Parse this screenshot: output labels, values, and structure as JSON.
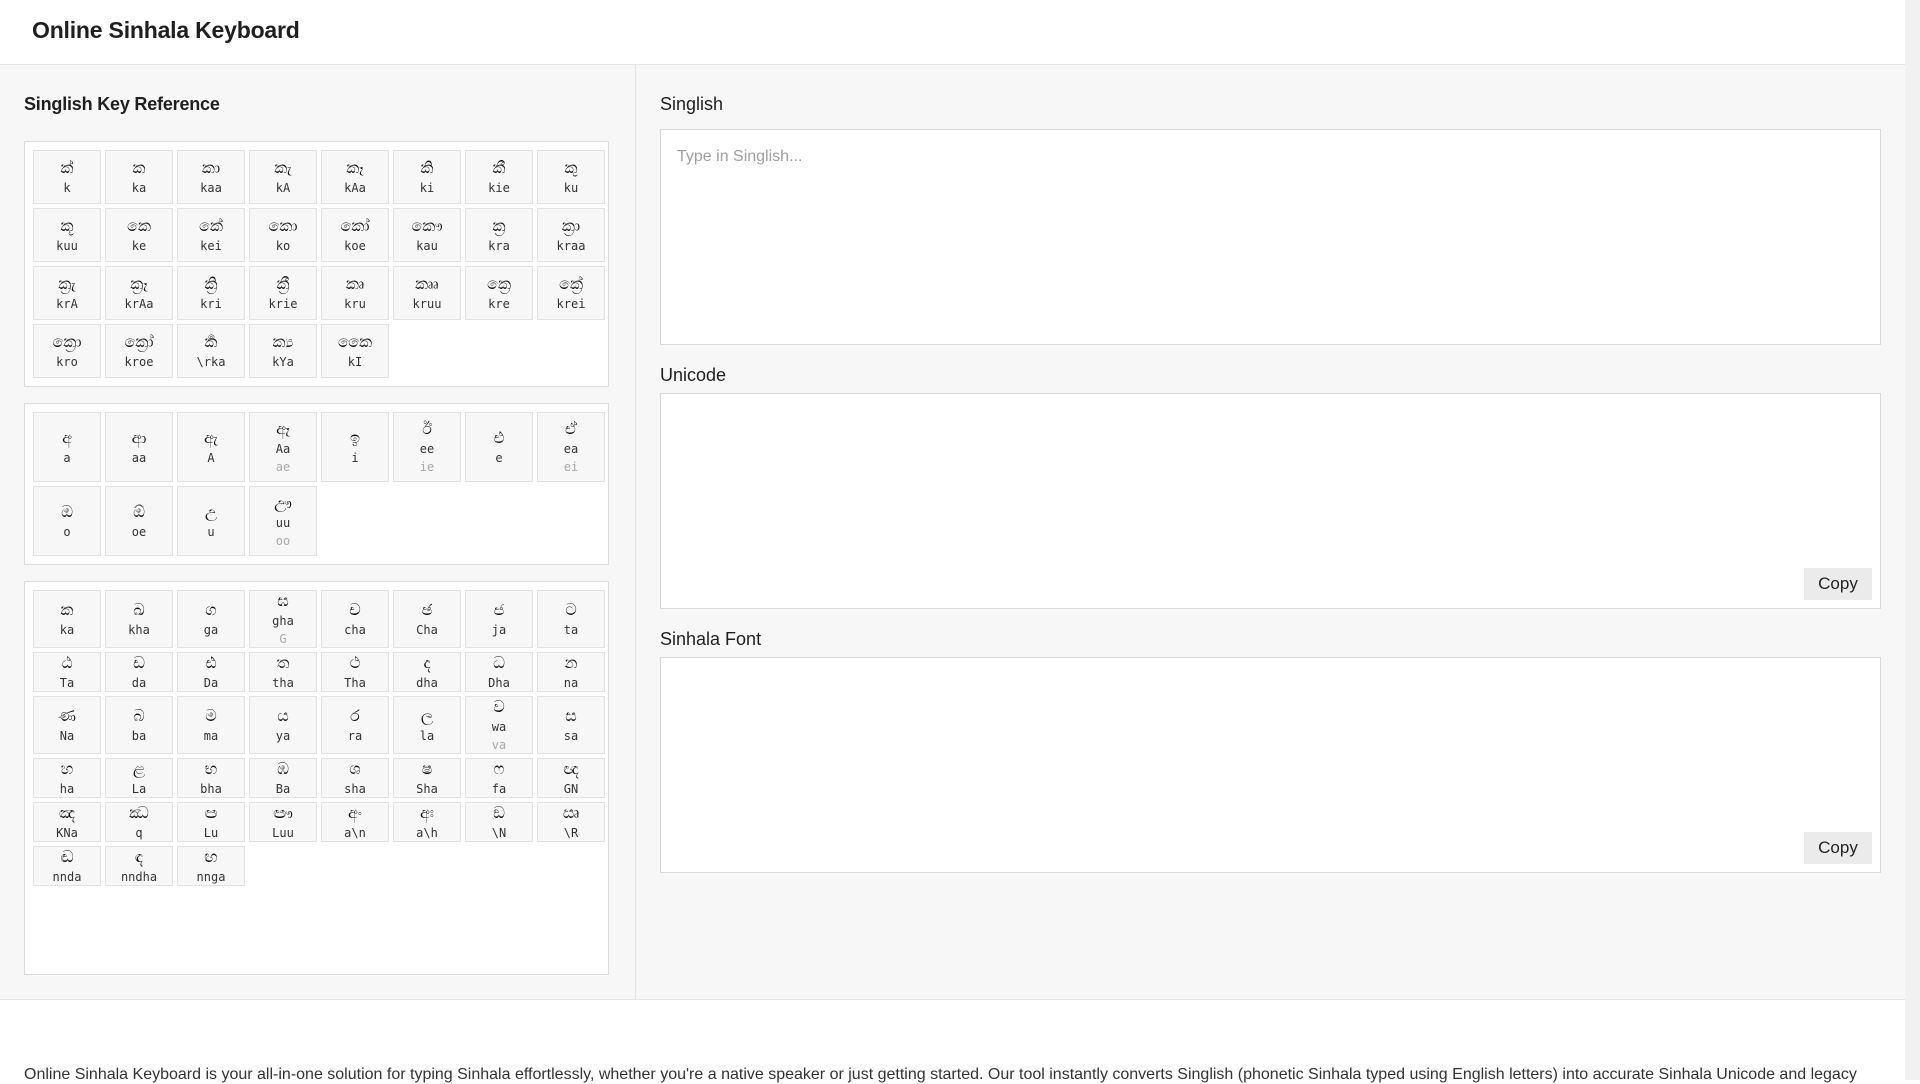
{
  "header": {
    "title": "Online Sinhala Keyboard"
  },
  "reference": {
    "title": "Singlish Key Reference",
    "groups": [
      {
        "id": "consonant-ka-forms",
        "keys": [
          {
            "si": "ක්",
            "latin": "k"
          },
          {
            "si": "ක",
            "latin": "ka"
          },
          {
            "si": "කා",
            "latin": "kaa"
          },
          {
            "si": "කැ",
            "latin": "kA"
          },
          {
            "si": "කෑ",
            "latin": "kAa"
          },
          {
            "si": "කි",
            "latin": "ki"
          },
          {
            "si": "කී",
            "latin": "kie"
          },
          {
            "si": "කු",
            "latin": "ku"
          },
          {
            "si": "කූ",
            "latin": "kuu"
          },
          {
            "si": "කෙ",
            "latin": "ke"
          },
          {
            "si": "කේ",
            "latin": "kei"
          },
          {
            "si": "කො",
            "latin": "ko"
          },
          {
            "si": "කෝ",
            "latin": "koe"
          },
          {
            "si": "කෞ",
            "latin": "kau"
          },
          {
            "si": "ක්‍ර",
            "latin": "kra"
          },
          {
            "si": "ක්‍රා",
            "latin": "kraa"
          },
          {
            "si": "ක්‍රැ",
            "latin": "krA"
          },
          {
            "si": "ක්‍රෑ",
            "latin": "krAa"
          },
          {
            "si": "ක්‍රි",
            "latin": "kri"
          },
          {
            "si": "ක්‍රී",
            "latin": "krie"
          },
          {
            "si": "කෘ",
            "latin": "kru"
          },
          {
            "si": "කෲ",
            "latin": "kruu"
          },
          {
            "si": "ක්‍රෙ",
            "latin": "kre"
          },
          {
            "si": "ක්‍රේ",
            "latin": "krei"
          },
          {
            "si": "ක්‍රො",
            "latin": "kro"
          },
          {
            "si": "ක්‍රෝ",
            "latin": "kroe"
          },
          {
            "si": "ර්‍ක",
            "latin": "\\rka"
          },
          {
            "si": "ක්‍ය",
            "latin": "kYa"
          },
          {
            "si": "කෛ",
            "latin": "kI"
          }
        ]
      },
      {
        "id": "vowels",
        "keys": [
          {
            "si": "අ",
            "latin": "a"
          },
          {
            "si": "ආ",
            "latin": "aa"
          },
          {
            "si": "ඇ",
            "latin": "A"
          },
          {
            "si": "ඈ",
            "latin": "Aa",
            "alt": "ae"
          },
          {
            "si": "ඉ",
            "latin": "i"
          },
          {
            "si": "ඊ",
            "latin": "ee",
            "alt": "ie"
          },
          {
            "si": "එ",
            "latin": "e"
          },
          {
            "si": "ඒ",
            "latin": "ea",
            "alt": "ei"
          },
          {
            "si": "ඔ",
            "latin": "o"
          },
          {
            "si": "ඕ",
            "latin": "oe"
          },
          {
            "si": "උ",
            "latin": "u"
          },
          {
            "si": "ඌ",
            "latin": "uu",
            "alt": "oo"
          }
        ]
      },
      {
        "id": "consonants",
        "keys": [
          {
            "si": "ක",
            "latin": "ka"
          },
          {
            "si": "ඛ",
            "latin": "kha"
          },
          {
            "si": "ග",
            "latin": "ga"
          },
          {
            "si": "ඝ",
            "latin": "gha",
            "alt": "G"
          },
          {
            "si": "ච",
            "latin": "cha"
          },
          {
            "si": "ඡ",
            "latin": "Cha"
          },
          {
            "si": "ජ",
            "latin": "ja"
          },
          {
            "si": "ට",
            "latin": "ta"
          },
          {
            "si": "ඨ",
            "latin": "Ta"
          },
          {
            "si": "ඩ",
            "latin": "da"
          },
          {
            "si": "ඪ",
            "latin": "Da"
          },
          {
            "si": "ත",
            "latin": "tha"
          },
          {
            "si": "ථ",
            "latin": "Tha"
          },
          {
            "si": "ද",
            "latin": "dha"
          },
          {
            "si": "ධ",
            "latin": "Dha"
          },
          {
            "si": "න",
            "latin": "na"
          },
          {
            "si": "ණ",
            "latin": "Na"
          },
          {
            "si": "බ",
            "latin": "ba"
          },
          {
            "si": "ම",
            "latin": "ma"
          },
          {
            "si": "ය",
            "latin": "ya"
          },
          {
            "si": "ර",
            "latin": "ra"
          },
          {
            "si": "ල",
            "latin": "la"
          },
          {
            "si": "ව",
            "latin": "wa",
            "alt": "va"
          },
          {
            "si": "ස",
            "latin": "sa"
          },
          {
            "si": "හ",
            "latin": "ha"
          },
          {
            "si": "ළ",
            "latin": "La"
          },
          {
            "si": "භ",
            "latin": "bha"
          },
          {
            "si": "ඹ",
            "latin": "Ba"
          },
          {
            "si": "ශ",
            "latin": "sha"
          },
          {
            "si": "ෂ",
            "latin": "Sha"
          },
          {
            "si": "ෆ",
            "latin": "fa"
          },
          {
            "si": "ඥ",
            "latin": "GN"
          },
          {
            "si": "ඤ",
            "latin": "KNa"
          },
          {
            "si": "ඣ",
            "latin": "q"
          },
          {
            "si": "ඏ",
            "latin": "Lu"
          },
          {
            "si": "ඐ",
            "latin": "Luu"
          },
          {
            "si": "අං",
            "latin": "a\\n"
          },
          {
            "si": "අඃ",
            "latin": "a\\h"
          },
          {
            "si": "ඞ",
            "latin": "\\N"
          },
          {
            "si": "ඍ",
            "latin": "\\R"
          },
          {
            "si": "ඬ",
            "latin": "nnda"
          },
          {
            "si": "ඳ",
            "latin": "nndha"
          },
          {
            "si": "ඟ",
            "latin": "nnga"
          }
        ]
      }
    ]
  },
  "singlish": {
    "label": "Singlish",
    "placeholder": "Type in Singlish..."
  },
  "unicode": {
    "label": "Unicode",
    "copy_label": "Copy"
  },
  "sinhala_font": {
    "label": "Sinhala Font",
    "copy_label": "Copy"
  },
  "footer": {
    "text": "Online Sinhala Keyboard is your all-in-one solution for typing Sinhala effortlessly, whether you're a native speaker or just getting started. Our tool instantly converts Singlish (phonetic Sinhala typed using English letters) into accurate Sinhala Unicode and legacy"
  }
}
